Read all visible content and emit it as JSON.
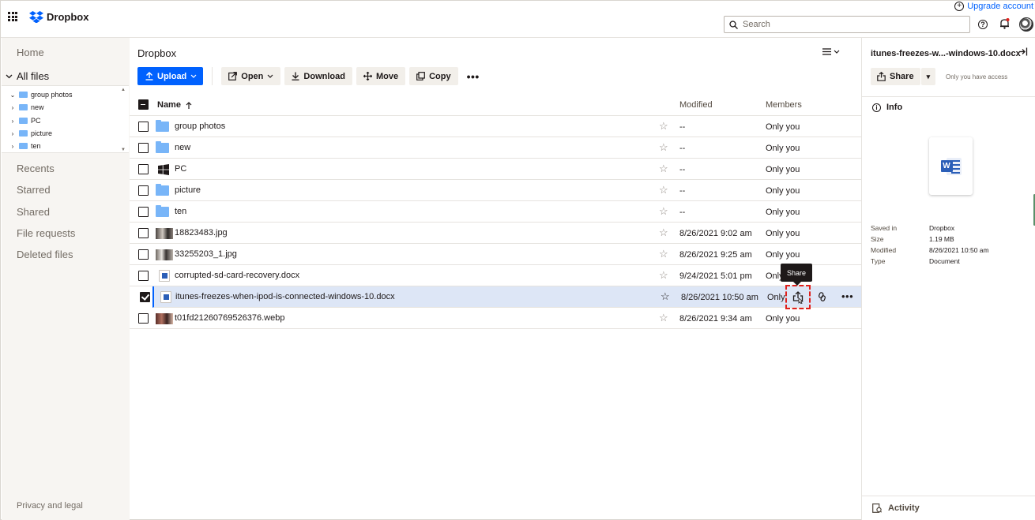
{
  "header": {
    "logo_text": "Dropbox",
    "upgrade_label": "Upgrade account",
    "search_placeholder": "Search"
  },
  "sidebar": {
    "home": "Home",
    "all_files": "All files",
    "tree": [
      {
        "label": "group photos",
        "expanded": true
      },
      {
        "label": "new",
        "expanded": false
      },
      {
        "label": "PC",
        "expanded": false
      },
      {
        "label": "picture",
        "expanded": false
      },
      {
        "label": "ten",
        "expanded": false
      }
    ],
    "recents": "Recents",
    "starred": "Starred",
    "shared": "Shared",
    "file_requests": "File requests",
    "deleted_files": "Deleted files",
    "privacy": "Privacy and legal"
  },
  "main": {
    "breadcrumb": "Dropbox",
    "toolbar": {
      "upload": "Upload",
      "open": "Open",
      "download": "Download",
      "move": "Move",
      "copy": "Copy"
    },
    "columns": {
      "name": "Name",
      "modified": "Modified",
      "members": "Members"
    },
    "rows": [
      {
        "name": "group photos",
        "type": "folder",
        "modified": "--",
        "members": "Only you"
      },
      {
        "name": "new",
        "type": "folder",
        "modified": "--",
        "members": "Only you"
      },
      {
        "name": "PC",
        "type": "windows",
        "modified": "--",
        "members": "Only you"
      },
      {
        "name": "picture",
        "type": "folder",
        "modified": "--",
        "members": "Only you"
      },
      {
        "name": "ten",
        "type": "folder",
        "modified": "--",
        "members": "Only you"
      },
      {
        "name": "18823483.jpg",
        "type": "image",
        "modified": "8/26/2021 9:02 am",
        "members": "Only you"
      },
      {
        "name": "33255203_1.jpg",
        "type": "image",
        "modified": "8/26/2021 9:25 am",
        "members": "Only you"
      },
      {
        "name": "corrupted-sd-card-recovery.docx",
        "type": "doc",
        "modified": "9/24/2021 5:01 pm",
        "members": "Only"
      },
      {
        "name": "itunes-freezes-when-ipod-is-connected-windows-10.docx",
        "type": "doc",
        "modified": "8/26/2021 10:50 am",
        "members": "Only",
        "selected": true
      },
      {
        "name": "t01fd21260769526376.webp",
        "type": "image",
        "modified": "8/26/2021 9:34 am",
        "members": "Only you"
      }
    ],
    "tooltip": "Share"
  },
  "detail": {
    "title": "itunes-freezes-w...-windows-10.docx",
    "share_label": "Share",
    "access_text": "Only you have access",
    "info_label": "Info",
    "meta": [
      {
        "key": "Saved in",
        "value": "Dropbox"
      },
      {
        "key": "Size",
        "value": "1.19 MB"
      },
      {
        "key": "Modified",
        "value": "8/26/2021 10:50 am"
      },
      {
        "key": "Type",
        "value": "Document"
      }
    ],
    "activity_label": "Activity"
  },
  "colors": {
    "accent": "#0061fe",
    "folder": "#78b5f8",
    "selected_row": "#dde6f6",
    "highlight_box": "#e0201c"
  }
}
